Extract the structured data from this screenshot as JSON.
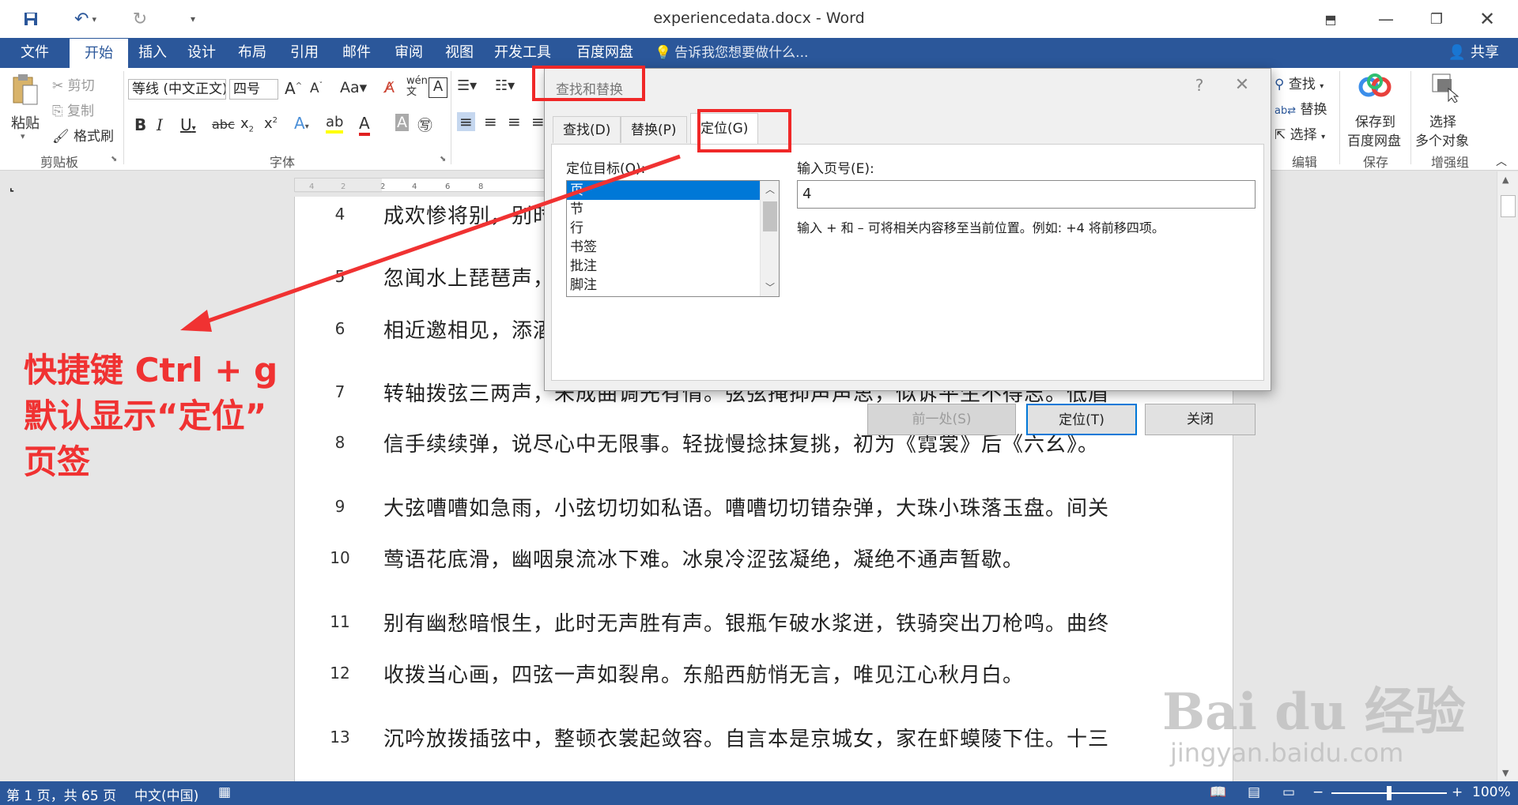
{
  "window": {
    "title": "experiencedata.docx - Word"
  },
  "ribbon_tabs": [
    {
      "label": "文件"
    },
    {
      "label": "开始"
    },
    {
      "label": "插入"
    },
    {
      "label": "设计"
    },
    {
      "label": "布局"
    },
    {
      "label": "引用"
    },
    {
      "label": "邮件"
    },
    {
      "label": "审阅"
    },
    {
      "label": "视图"
    },
    {
      "label": "开发工具"
    },
    {
      "label": "百度网盘"
    }
  ],
  "tell_me": "告诉我您想要做什么...",
  "share_label": "共享",
  "ribbon": {
    "paste": "粘贴",
    "cut": "剪切",
    "copy": "复制",
    "format_painter": "格式刷",
    "clipboard_group": "剪贴板",
    "font_name": "等线 (中文正文)",
    "font_size": "四号",
    "font_group": "字体",
    "find": "查找",
    "replace": "替换",
    "select": "选择",
    "edit_group": "编辑",
    "save_to_baidu": "保存到",
    "save_to_baidu2": "百度网盘",
    "save_group": "保存",
    "select_multiple": "选择",
    "select_multiple2": "多个对象",
    "addin_group": "增强组"
  },
  "document": {
    "lines": [
      {
        "num": "4",
        "text": "成欢惨将别，别时"
      },
      {
        "num": "5",
        "text": "忽闻水上琵琶声，"
      },
      {
        "num": "6",
        "text": "相近邀相见，添酒"
      },
      {
        "num": "7",
        "text": "转轴拨弦三两声，未成曲调先有情。弦弦掩抑声声思，似诉平生不得志。低眉"
      },
      {
        "num": "8",
        "text": "信手续续弹，说尽心中无限事。轻拢慢捻抹复挑，初为《霓裳》后《六幺》。"
      },
      {
        "num": "9",
        "text": "大弦嘈嘈如急雨，小弦切切如私语。嘈嘈切切错杂弹，大珠小珠落玉盘。间关"
      },
      {
        "num": "10",
        "text": "莺语花底滑，幽咽泉流冰下难。冰泉冷涩弦凝绝，凝绝不通声暂歇。"
      },
      {
        "num": "11",
        "text": "别有幽愁暗恨生，此时无声胜有声。银瓶乍破水浆迸，铁骑突出刀枪鸣。曲终"
      },
      {
        "num": "12",
        "text": "收拨当心画，四弦一声如裂帛。东船西舫悄无言，唯见江心秋月白。"
      },
      {
        "num": "13",
        "text": "沉吟放拨插弦中，整顿衣裳起敛容。自言本是京城女，家在虾蟆陵下住。十三"
      }
    ]
  },
  "status": {
    "page": "第 1 页，共 65 页",
    "language": "中文(中国)",
    "zoom": "100%",
    "zoom_level": 1.0
  },
  "annotation": {
    "line1": "快捷键 Ctrl + g",
    "line2": "默认显示“定位”",
    "line3": "页签"
  },
  "dialog": {
    "title": "查找和替换",
    "help": "?",
    "tabs": [
      {
        "label": "查找(D)"
      },
      {
        "label": "替换(P)"
      },
      {
        "label": "定位(G)"
      }
    ],
    "target_label": "定位目标(O):",
    "targets": [
      "页",
      "节",
      "行",
      "书签",
      "批注",
      "脚注"
    ],
    "selected_target": "页",
    "page_label": "输入页号(E):",
    "page_value": "4",
    "hint": "输入 + 和 – 可将相关内容移至当前位置。例如: +4 将前移四项。",
    "prev_button": "前一处(S)",
    "goto_button": "定位(T)",
    "close_button": "关闭"
  },
  "watermark": {
    "brand": "Bai du 经验",
    "url": "jingyan.baidu.com"
  },
  "colors": {
    "word_blue": "#2b579a",
    "annotation_red": "#f03232",
    "selection_blue": "#0078d7"
  }
}
